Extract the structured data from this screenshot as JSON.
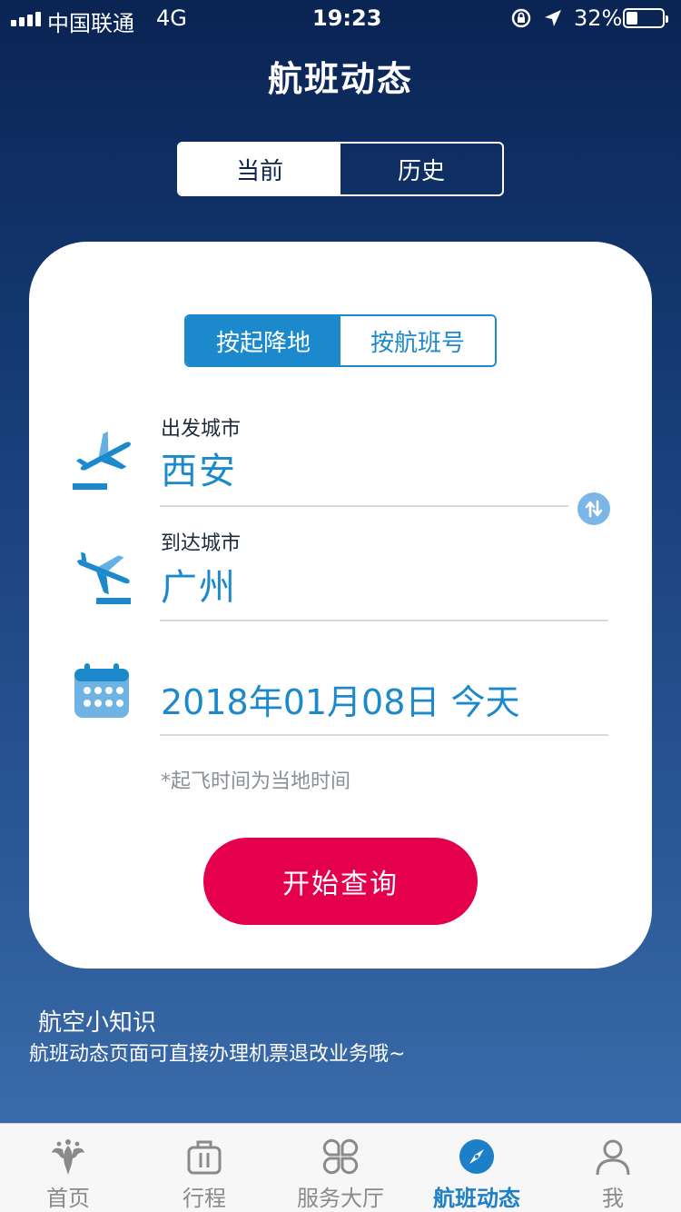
{
  "status_bar": {
    "carrier": "中国联通",
    "network": "4G",
    "time": "19:23",
    "battery": "32%",
    "battery_level": 0.32,
    "icons": [
      "signal-icon",
      "rotation-lock-icon",
      "location-icon",
      "battery-icon"
    ]
  },
  "header": {
    "title": "航班动态"
  },
  "top_tabs": [
    {
      "label": "当前",
      "selected": true
    },
    {
      "label": "历史",
      "selected": false
    }
  ],
  "search_card": {
    "mode_tabs": [
      {
        "label": "按起降地",
        "selected": true
      },
      {
        "label": "按航班号",
        "selected": false
      }
    ],
    "departure": {
      "label": "出发城市",
      "value": "西安",
      "icon": "takeoff-icon"
    },
    "arrival": {
      "label": "到达城市",
      "value": "广州",
      "icon": "landing-icon"
    },
    "swap_icon": "swap-icon",
    "date": {
      "value": "2018年01月08日 今天",
      "icon": "calendar-icon"
    },
    "note": "*起飞时间为当地时间",
    "search_button": "开始查询"
  },
  "tips": {
    "title": "航空小知识",
    "text": "航班动态页面可直接办理机票退改业务哦~"
  },
  "tab_bar": [
    {
      "label": "首页",
      "icon": "home-logo-icon",
      "active": false
    },
    {
      "label": "行程",
      "icon": "luggage-icon",
      "active": false
    },
    {
      "label": "服务大厅",
      "icon": "services-grid-icon",
      "active": false
    },
    {
      "label": "航班动态",
      "icon": "compass-icon",
      "active": true
    },
    {
      "label": "我",
      "icon": "person-icon",
      "active": false
    }
  ],
  "colors": {
    "accent_blue": "#1c89cc",
    "search_button": "#e4004d",
    "background_top": "#0a2453",
    "background_bottom": "#3a6aa9"
  }
}
